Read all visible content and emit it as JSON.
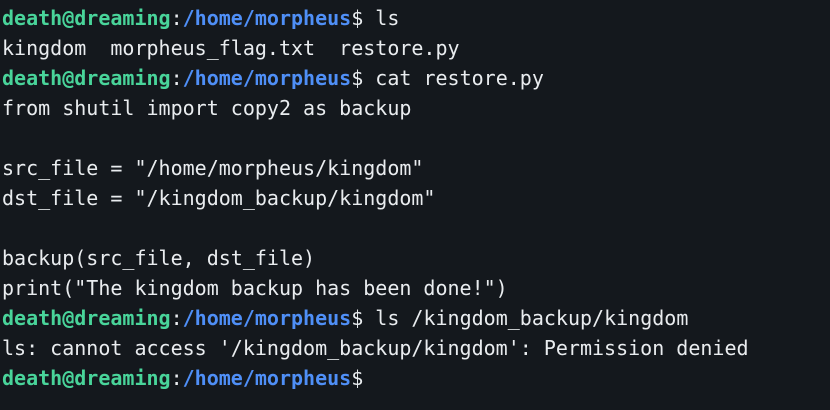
{
  "prompt": {
    "user_host": "death@dreaming",
    "separator": ":",
    "path": "/home/morpheus",
    "symbol": "$"
  },
  "lines": [
    {
      "type": "prompt",
      "command": " ls"
    },
    {
      "type": "output",
      "text": "kingdom  morpheus_flag.txt  restore.py"
    },
    {
      "type": "prompt",
      "command": " cat restore.py"
    },
    {
      "type": "output",
      "text": "from shutil import copy2 as backup"
    },
    {
      "type": "output",
      "text": ""
    },
    {
      "type": "output",
      "text": "src_file = \"/home/morpheus/kingdom\""
    },
    {
      "type": "output",
      "text": "dst_file = \"/kingdom_backup/kingdom\""
    },
    {
      "type": "output",
      "text": ""
    },
    {
      "type": "output",
      "text": "backup(src_file, dst_file)"
    },
    {
      "type": "output",
      "text": "print(\"The kingdom backup has been done!\")"
    },
    {
      "type": "prompt",
      "command": " ls /kingdom_backup/kingdom"
    },
    {
      "type": "output",
      "text": "ls: cannot access '/kingdom_backup/kingdom': Permission denied"
    },
    {
      "type": "prompt",
      "command": ""
    }
  ]
}
